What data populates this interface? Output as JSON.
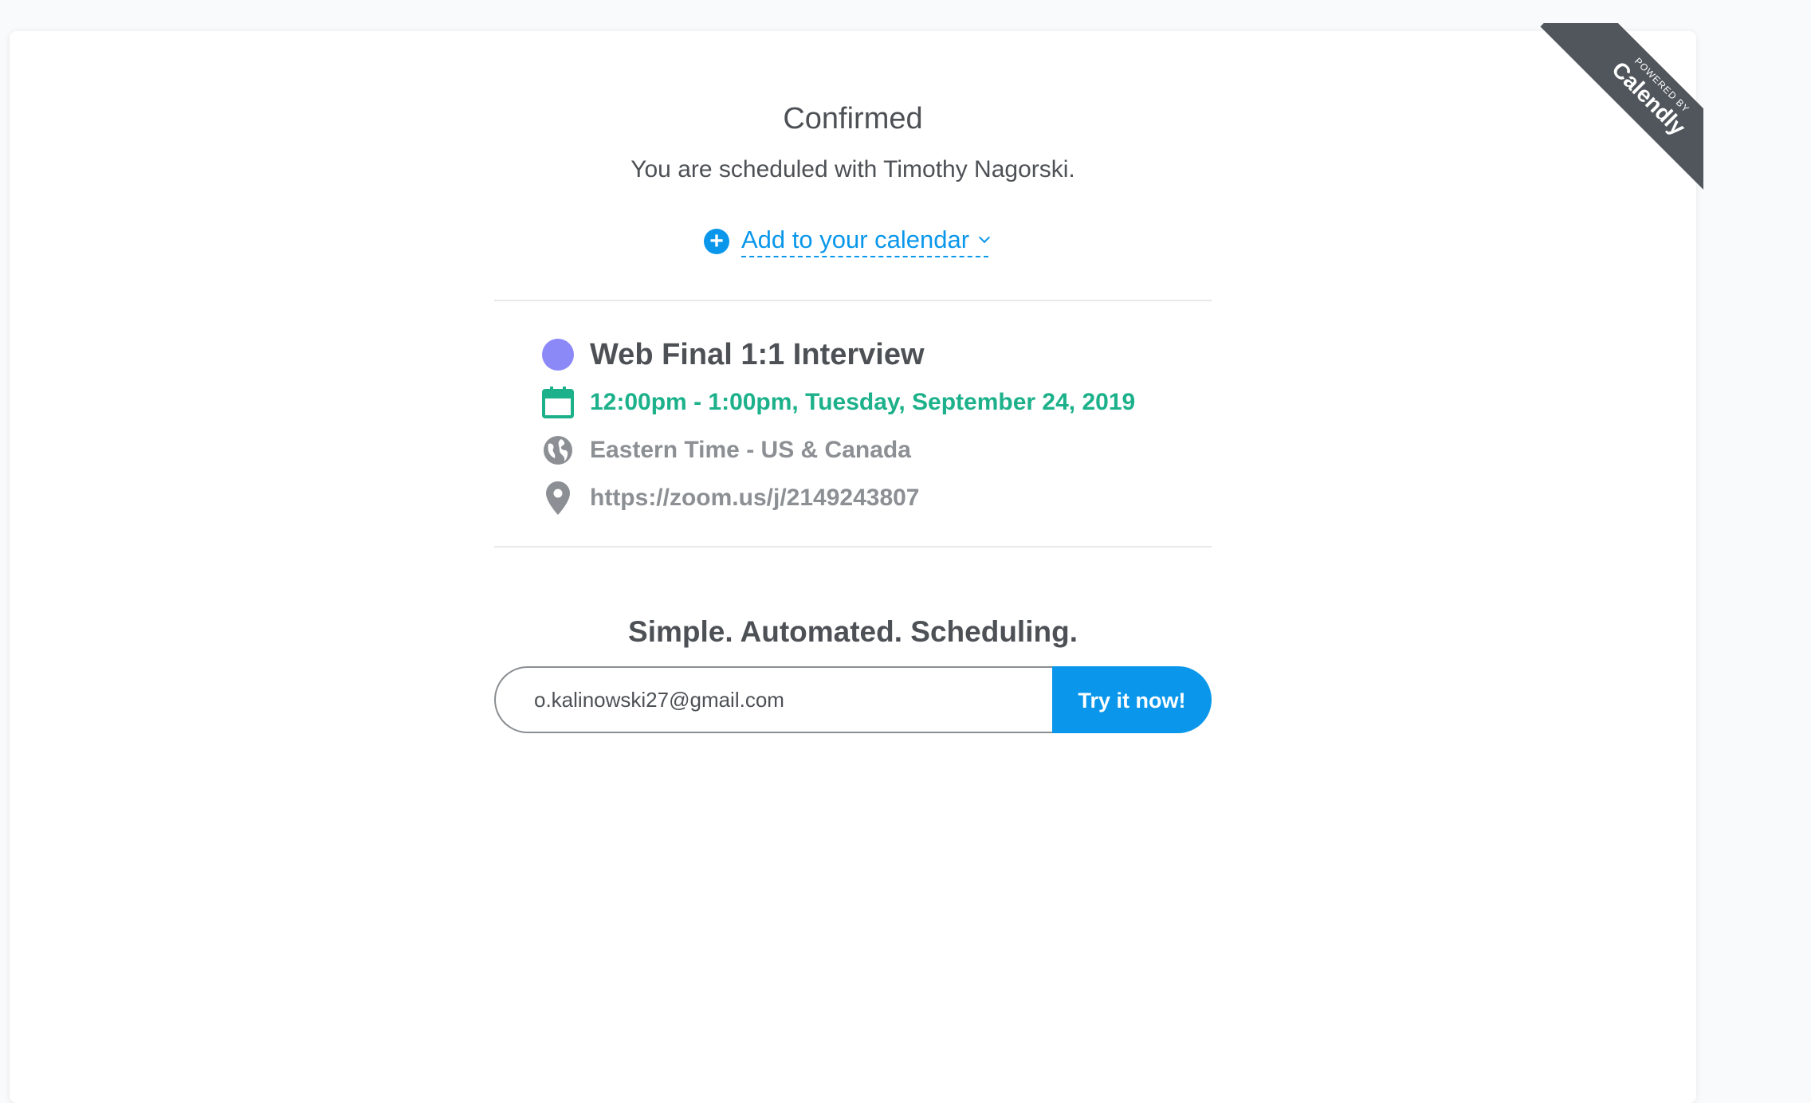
{
  "ribbon": {
    "small_text": "POWERED BY",
    "brand": "Calendly"
  },
  "confirmation": {
    "title": "Confirmed",
    "subtitle": "You are scheduled with Timothy Nagorski.",
    "add_to_calendar_label": "Add to your calendar"
  },
  "event": {
    "name": "Web Final 1:1 Interview",
    "time": "12:00pm - 1:00pm, Tuesday, September 24, 2019",
    "timezone": "Eastern Time - US & Canada",
    "location": "https://zoom.us/j/2149243807",
    "dot_color": "#8b88f8",
    "time_color": "#1cb18a"
  },
  "signup": {
    "tagline": "Simple. Automated. Scheduling.",
    "email_value": "o.kalinowski27@gmail.com",
    "button_label": "Try it now!",
    "button_color": "#0a97eb"
  }
}
